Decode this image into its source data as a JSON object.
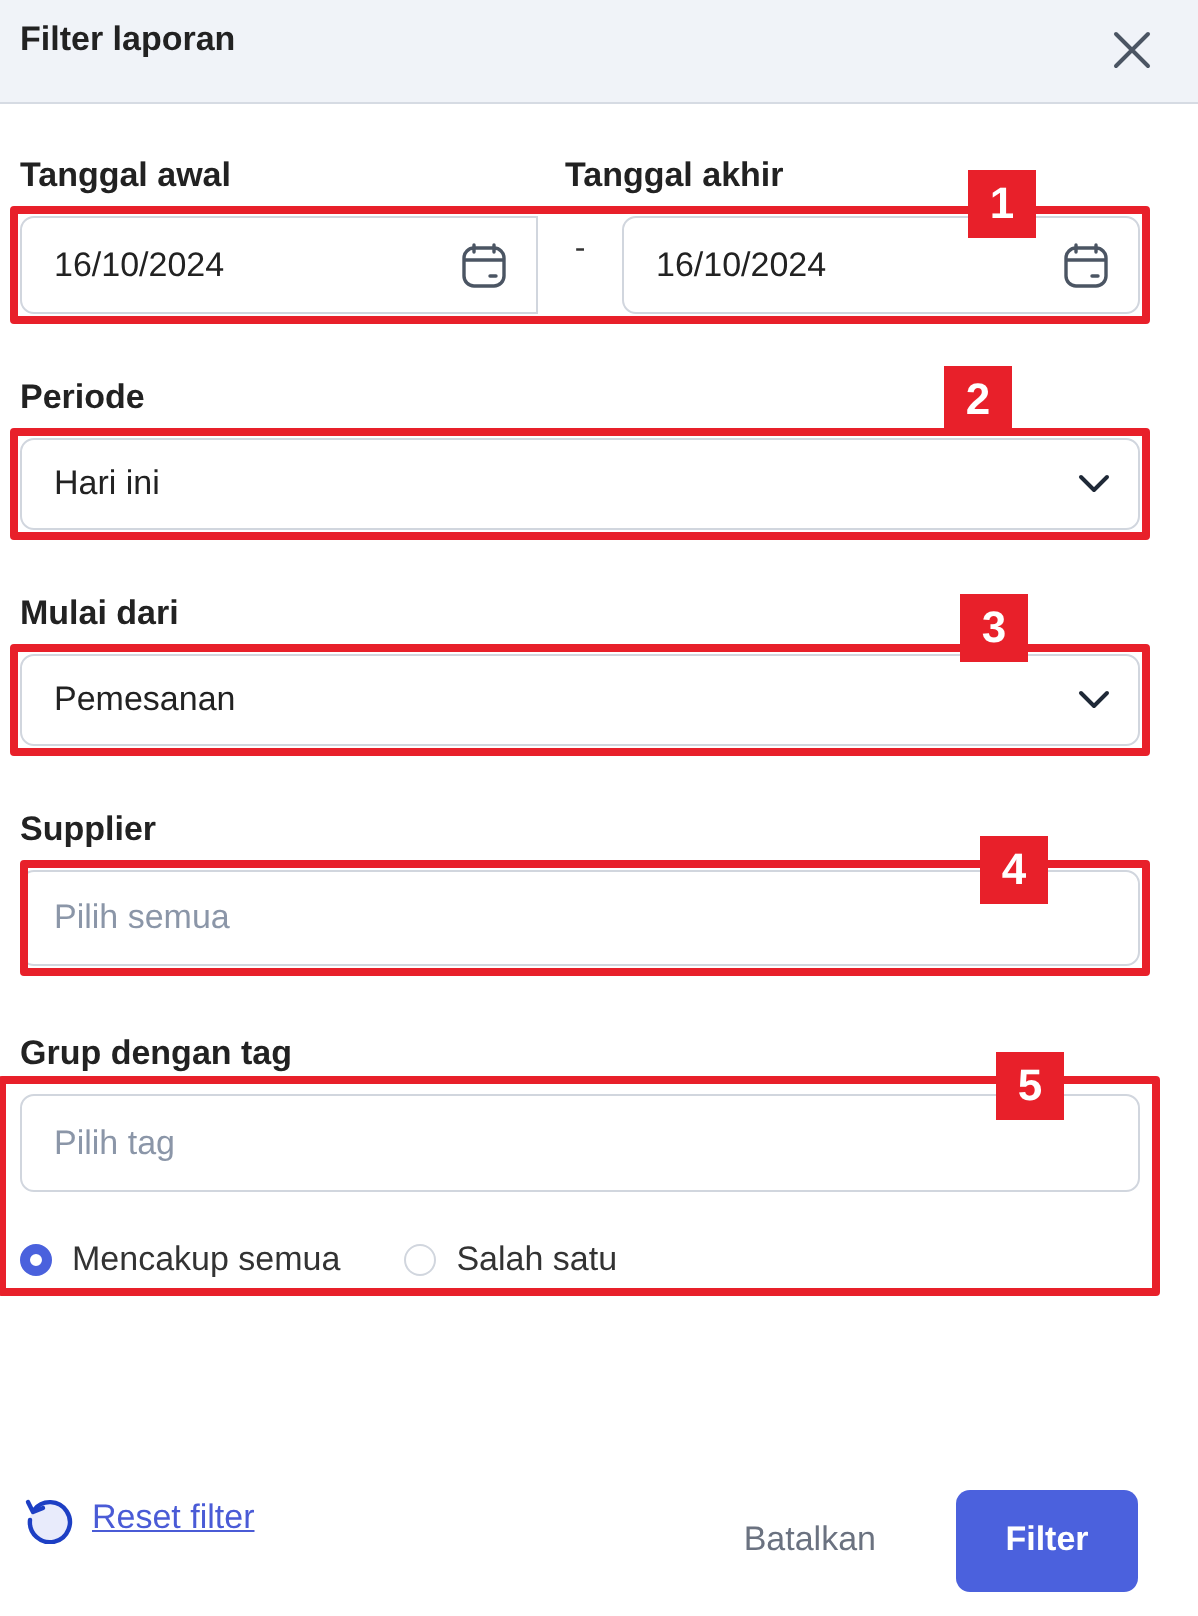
{
  "header": {
    "title": "Filter laporan"
  },
  "date_range": {
    "start": {
      "label": "Tanggal awal",
      "value": "16/10/2024"
    },
    "separator": "-",
    "end": {
      "label": "Tanggal akhir",
      "value": "16/10/2024"
    }
  },
  "periode": {
    "label": "Periode",
    "value": "Hari ini"
  },
  "mulai_dari": {
    "label": "Mulai dari",
    "value": "Pemesanan"
  },
  "supplier": {
    "label": "Supplier",
    "placeholder": "Pilih semua"
  },
  "tag_group": {
    "label": "Grup dengan tag",
    "placeholder": "Pilih tag",
    "options": [
      {
        "label": "Mencakup semua",
        "selected": true
      },
      {
        "label": "Salah satu",
        "selected": false
      }
    ]
  },
  "footer": {
    "reset_link": "Reset filter",
    "cancel_button": "Batalkan",
    "submit_button": "Filter"
  },
  "annotations": [
    {
      "number": "1"
    },
    {
      "number": "2"
    },
    {
      "number": "3"
    },
    {
      "number": "4"
    },
    {
      "number": "5"
    }
  ]
}
